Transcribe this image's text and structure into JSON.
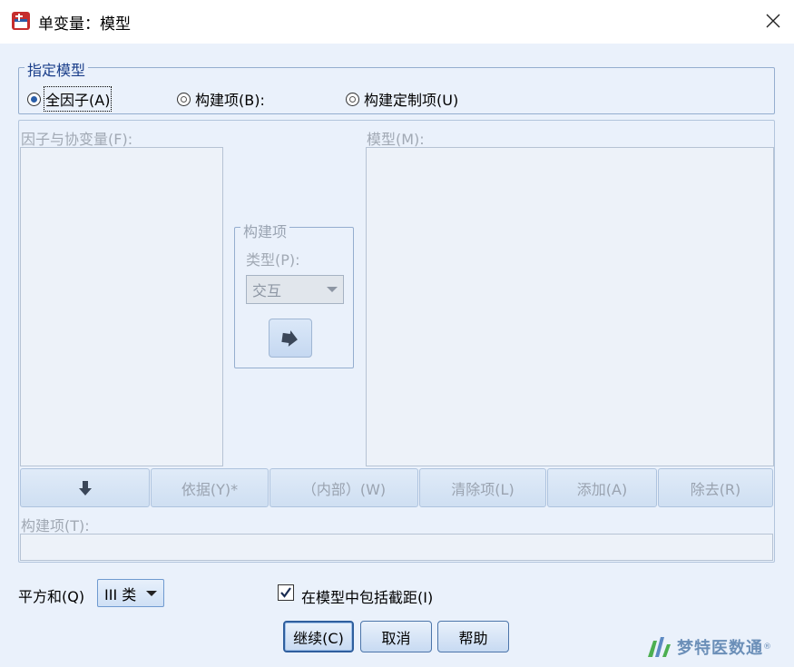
{
  "window": {
    "title": "单变量：模型"
  },
  "specify_model": {
    "legend": "指定模型",
    "options": [
      {
        "label": "全因子(A)",
        "selected": true
      },
      {
        "label": "构建项(B):",
        "selected": false
      },
      {
        "label": "构建定制项(U)",
        "selected": false
      }
    ]
  },
  "factors_label": "因子与协变量(F):",
  "model_label": "模型(M):",
  "build_term": {
    "legend": "构建项",
    "type_label": "类型(P):",
    "type_value": "交互"
  },
  "term_buttons": [
    {
      "label": ""
    },
    {
      "label": "依据(Y)*"
    },
    {
      "label": "（内部）(W)"
    },
    {
      "label": "清除项(L)"
    },
    {
      "label": "添加(A)"
    },
    {
      "label": "除去(R)"
    }
  ],
  "build_term_label": "构建项(T):",
  "sum_of_squares": {
    "label": "平方和(Q)",
    "value": "III 类"
  },
  "include_intercept": {
    "label": "在模型中包括截距(I)",
    "checked": true
  },
  "actions": {
    "continue": "继续(C)",
    "cancel": "取消",
    "help": "帮助"
  },
  "watermark": {
    "text": "梦特医数通",
    "mark": "®"
  },
  "colors": {
    "accent": "#1a3e8a",
    "disabled_text": "#a1a9b4",
    "background": "#eaf1fb"
  }
}
